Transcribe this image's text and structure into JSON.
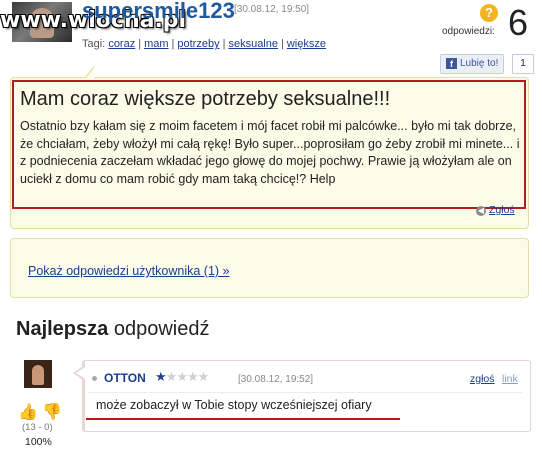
{
  "header": {
    "watermark": "www.wiocha.pl",
    "username": "supersmile123",
    "post_date": "[30.08.12, 19:50]",
    "tags_label": "Tagi:",
    "tags": [
      "coraz",
      "mam",
      "potrzeby",
      "seksualne",
      "większe"
    ],
    "answers_label": "odpowiedzi:",
    "answers_count": "6",
    "question_icon": "?",
    "like_label": "Lubię to!",
    "like_fb_icon": "f",
    "like_count": "1"
  },
  "question": {
    "title": "Mam coraz większe potrzeby seksualne!!!",
    "body": "Ostatnio bzy kałam się z moim facetem i mój facet robił mi palcówke... było mi tak dobrze, że chciałam, żeby włożył mi całą rękę! Było super...poprosiłam go żeby zrobił mi minete... i z podniecenia zaczełam wkładać jego głowę do mojej pochwy. Prawie ją włożyłam ale on uciekł z domu co mam robić gdy mam taką chcicę!? Help",
    "report_label": "Zgłoś"
  },
  "user_answers": {
    "link_label": "Pokaż odpowiedzi użytkownika (1) »"
  },
  "best_answer": {
    "heading_bold": "Najlepsza",
    "heading_rest": "odpowiedź",
    "user": "OTTON",
    "stars_total": 5,
    "stars_filled": 1,
    "date": "[30.08.12, 19:52]",
    "report_label": "zgłoś",
    "link_label": "link",
    "text": "może zobaczył w Tobie stopy wcześniejszej ofiary",
    "vote_counts": "(13 - 0)",
    "vote_percent": "100%"
  },
  "colors": {
    "accent_blue": "#1f5a9e",
    "highlight_red": "#b51c1c",
    "box_yellow": "#fcfbe8"
  },
  "icons": [
    "question-mark-icon",
    "facebook-icon",
    "report-icon",
    "thumbs-up-icon",
    "thumbs-down-icon",
    "star-icon"
  ]
}
